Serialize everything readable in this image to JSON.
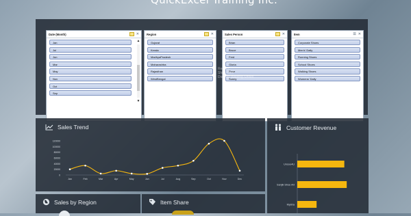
{
  "page_title": "QuickExcel Training Inc.",
  "slicers": {
    "date": {
      "title": "Date (Month)",
      "items": [
        "Jan",
        "Jul",
        "Jun",
        "Mar",
        "May",
        "Nov",
        "Oct",
        "Sep"
      ]
    },
    "region": {
      "title": "Region",
      "items": [
        "Gujarat",
        "Kerala",
        "MadhyaPradesh",
        "Maharashtra",
        "Rajasthan",
        "WestBengal"
      ]
    },
    "salesperson": {
      "title": "Sales Person",
      "items": [
        "Brian",
        "Bruce",
        "Fred",
        "Gloria",
        "Rose",
        "Sunny"
      ]
    },
    "item": {
      "title": "Item",
      "items": [
        "Corporate Shoes",
        "Men's' Daily",
        "Running Shoes",
        "School Shoes",
        "Walking Shoes",
        "Womens' Daily"
      ]
    },
    "ghost_tooltip": [
      "Region",
      "Shiny Gell",
      "Display: Walking Shoes"
    ]
  },
  "panels": {
    "sales_trend": {
      "title": "Sales Trend",
      "icon": "line-chart-icon"
    },
    "customer_revenue": {
      "title": "Customer Revenue",
      "icon": "people-icon"
    },
    "sales_region": {
      "title": "Sales by Region",
      "icon": "globe-icon"
    },
    "item_share": {
      "title": "Item Share",
      "icon": "tag-icon"
    }
  },
  "colors": {
    "panel_bg": "#242c37",
    "line": "#f6b70f",
    "bar": "#f6b70f",
    "slicer_item": "#c9d5ee"
  },
  "chart_data": [
    {
      "type": "line",
      "title": "Sales Trend",
      "categories": [
        "Jan",
        "Feb",
        "Mar",
        "Apr",
        "May",
        "Jun",
        "Jul",
        "Aug",
        "Sep",
        "Oct",
        "Nov",
        "Dec"
      ],
      "values": [
        20000,
        33000,
        5000,
        15000,
        5000,
        4000,
        25000,
        33000,
        50000,
        110000,
        120000,
        15000
      ],
      "ylim": [
        0,
        120000
      ],
      "yticks": [
        "0",
        "20000",
        "40000",
        "60000",
        "80000",
        "100000",
        "120000"
      ]
    },
    {
      "type": "bar",
      "title": "Customer Revenue",
      "orientation": "horizontal",
      "categories": [
        "Unsoo4U",
        "Sanjik Shoe Art",
        "Mystra"
      ],
      "values": [
        78,
        82,
        32
      ],
      "xlim": [
        0,
        100
      ]
    }
  ]
}
